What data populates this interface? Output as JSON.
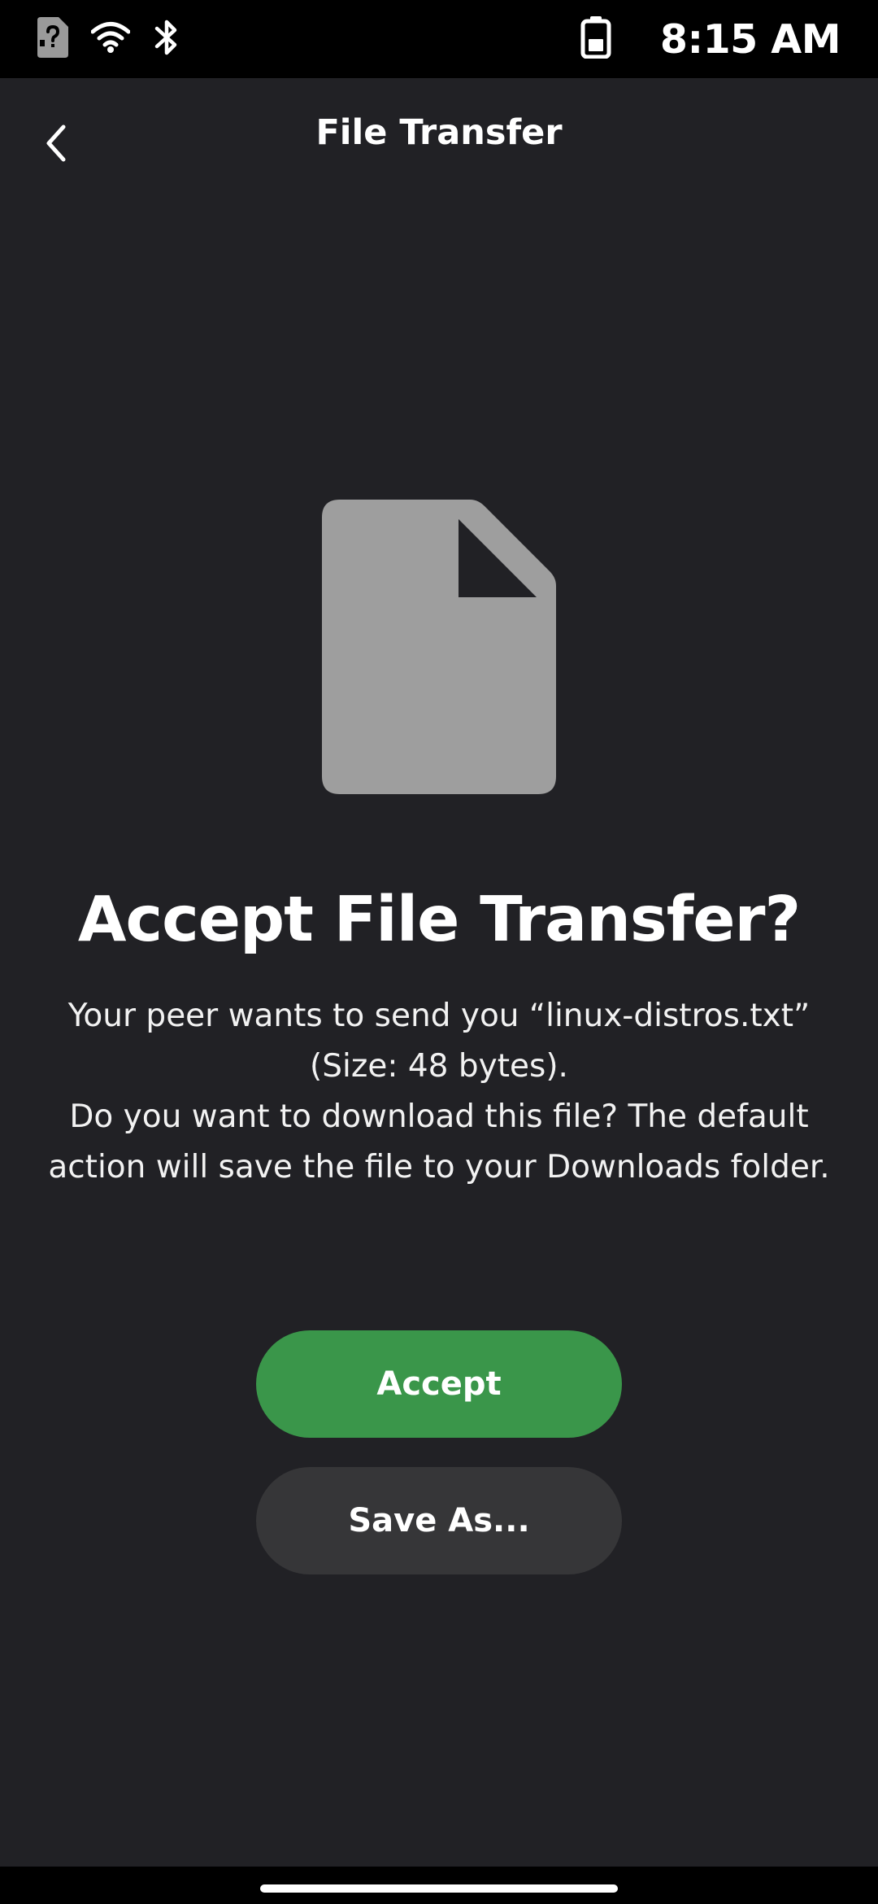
{
  "status_bar": {
    "time": "8:15 AM",
    "icons": [
      "sim-unknown-icon",
      "wifi-icon",
      "bluetooth-icon",
      "battery-icon"
    ]
  },
  "topbar": {
    "title": "File Transfer",
    "back_icon": "chevron-left-icon"
  },
  "main": {
    "file_icon": "document-icon",
    "heading": "Accept File Transfer?",
    "message_line1": "Your peer wants to send you “linux-distros.txt” (Size: 48 bytes).",
    "message_line2": "Do you want to download this file? The default action will save the file to your Downloads folder."
  },
  "actions": {
    "accept_label": "Accept",
    "save_as_label": "Save As..."
  },
  "colors": {
    "background": "#212125",
    "accept": "#3a964a",
    "secondary": "#363638",
    "icon": "#9e9e9e"
  }
}
